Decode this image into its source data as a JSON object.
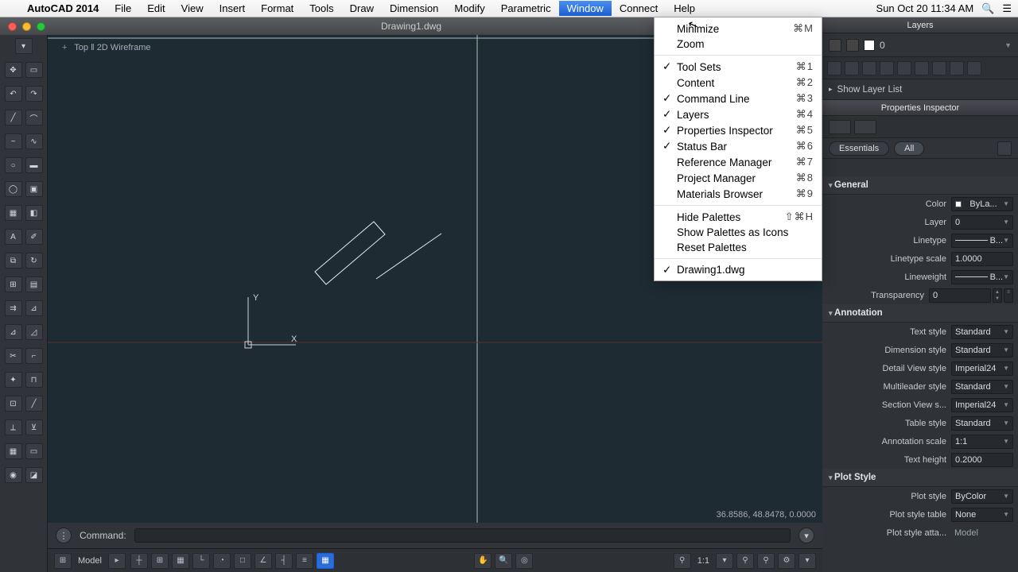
{
  "menubar": {
    "app": "AutoCAD 2014",
    "items": [
      "File",
      "Edit",
      "View",
      "Insert",
      "Format",
      "Tools",
      "Draw",
      "Dimension",
      "Modify",
      "Parametric",
      "Window",
      "Connect",
      "Help"
    ],
    "active_index": 10,
    "datetime": "Sun Oct 20  11:34 AM"
  },
  "window": {
    "title": "Drawing1.dwg"
  },
  "dropdown": {
    "rows": [
      {
        "label": "Minimize",
        "shortcut": "⌘M"
      },
      {
        "label": "Zoom"
      },
      {
        "sep": true
      },
      {
        "label": "Tool Sets",
        "shortcut": "⌘1",
        "checked": true
      },
      {
        "label": "Content",
        "shortcut": "⌘2"
      },
      {
        "label": "Command Line",
        "shortcut": "⌘3",
        "checked": true
      },
      {
        "label": "Layers",
        "shortcut": "⌘4",
        "checked": true
      },
      {
        "label": "Properties Inspector",
        "shortcut": "⌘5",
        "checked": true
      },
      {
        "label": "Status Bar",
        "shortcut": "⌘6",
        "checked": true
      },
      {
        "label": "Reference Manager",
        "shortcut": "⌘7"
      },
      {
        "label": "Project Manager",
        "shortcut": "⌘8"
      },
      {
        "label": "Materials Browser",
        "shortcut": "⌘9"
      },
      {
        "sep": true
      },
      {
        "label": "Hide Palettes",
        "shortcut": "⇧⌘H"
      },
      {
        "label": "Show Palettes as Icons"
      },
      {
        "label": "Reset Palettes"
      },
      {
        "sep": true
      },
      {
        "label": "Drawing1.dwg",
        "checked": true
      }
    ]
  },
  "workspace": {
    "view_label_plus": "+",
    "view_label": "Top ‖ 2D Wireframe",
    "coordinates": "36.8586, 48.8478, 0.0000",
    "axes": {
      "x": "X",
      "y": "Y"
    }
  },
  "command": {
    "label": "Command:"
  },
  "statusbar": {
    "model": "Model",
    "scale": "1:1"
  },
  "layers": {
    "header": "Layers",
    "current": "0",
    "show_list": "Show Layer List"
  },
  "pi": {
    "header": "Properties Inspector",
    "pill_essentials": "Essentials",
    "pill_all": "All",
    "groups": {
      "general": {
        "title": "General",
        "rows": [
          {
            "label": "Color",
            "value": "ByLa...",
            "swatch": true,
            "dd": true
          },
          {
            "label": "Layer",
            "value": "0",
            "dd": true
          },
          {
            "label": "Linetype",
            "value": "B...",
            "line": true,
            "dd": true
          },
          {
            "label": "Linetype scale",
            "value": "1.0000",
            "plain": true
          },
          {
            "label": "Lineweight",
            "value": "B...",
            "line": true,
            "dd": true
          },
          {
            "label": "Transparency",
            "value": "0",
            "plain": true,
            "spin": true
          }
        ]
      },
      "annotation": {
        "title": "Annotation",
        "rows": [
          {
            "label": "Text style",
            "value": "Standard",
            "dd": true
          },
          {
            "label": "Dimension style",
            "value": "Standard",
            "dd": true
          },
          {
            "label": "Detail View style",
            "value": "Imperial24",
            "dd": true
          },
          {
            "label": "Multileader style",
            "value": "Standard",
            "dd": true
          },
          {
            "label": "Section View s...",
            "value": "Imperial24",
            "dd": true
          },
          {
            "label": "Table style",
            "value": "Standard",
            "dd": true
          },
          {
            "label": "Annotation scale",
            "value": "1:1",
            "dd": true
          },
          {
            "label": "Text height",
            "value": "0.2000",
            "plain": true
          }
        ]
      },
      "plotstyle": {
        "title": "Plot Style",
        "rows": [
          {
            "label": "Plot style",
            "value": "ByColor",
            "dd": true
          },
          {
            "label": "Plot style table",
            "value": "None",
            "dd": true
          },
          {
            "label": "Plot style atta...",
            "value": "Model",
            "nobox": true
          }
        ]
      }
    }
  }
}
